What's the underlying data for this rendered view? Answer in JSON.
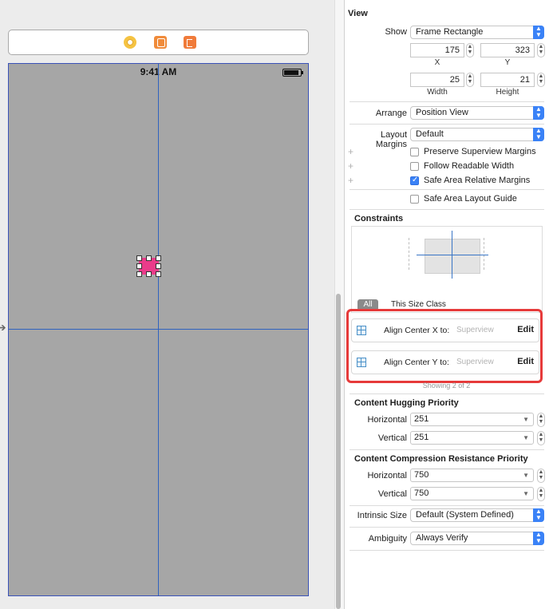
{
  "canvas": {
    "status_time": "9:41 AM"
  },
  "inspector": {
    "view_title": "View",
    "show_label": "Show",
    "show_value": "Frame Rectangle",
    "x_value": "175",
    "y_value": "323",
    "x_label": "X",
    "y_label": "Y",
    "width_value": "25",
    "height_value": "21",
    "width_label": "Width",
    "height_label": "Height",
    "arrange_label": "Arrange",
    "arrange_value": "Position View",
    "layout_margins_label": "Layout Margins",
    "layout_margins_value": "Default",
    "checkboxes": [
      {
        "label": "Preserve Superview Margins",
        "checked": false
      },
      {
        "label": "Follow Readable Width",
        "checked": false
      },
      {
        "label": "Safe Area Relative Margins",
        "checked": true
      },
      {
        "label": "Safe Area Layout Guide",
        "checked": false
      }
    ],
    "constraints_title": "Constraints",
    "segment_all": "All",
    "segment_size_class": "This Size Class",
    "constraint_rows": [
      {
        "label": "Align Center X to:",
        "target": "Superview",
        "edit": "Edit"
      },
      {
        "label": "Align Center Y to:",
        "target": "Superview",
        "edit": "Edit"
      }
    ],
    "showing_text": "Showing 2 of 2",
    "hugging_title": "Content Hugging Priority",
    "hugging_horizontal_label": "Horizontal",
    "hugging_horizontal_value": "251",
    "hugging_vertical_label": "Vertical",
    "hugging_vertical_value": "251",
    "compression_title": "Content Compression Resistance Priority",
    "compression_horizontal_label": "Horizontal",
    "compression_horizontal_value": "750",
    "compression_vertical_label": "Vertical",
    "compression_vertical_value": "750",
    "intrinsic_label": "Intrinsic Size",
    "intrinsic_value": "Default (System Defined)",
    "ambiguity_label": "Ambiguity",
    "ambiguity_value": "Always Verify"
  },
  "colors": {
    "accent": "#3a82f7",
    "highlight_box": "#e63a3a",
    "selected_view": "#ea3b8a",
    "guide_line": "#2f62bf"
  }
}
